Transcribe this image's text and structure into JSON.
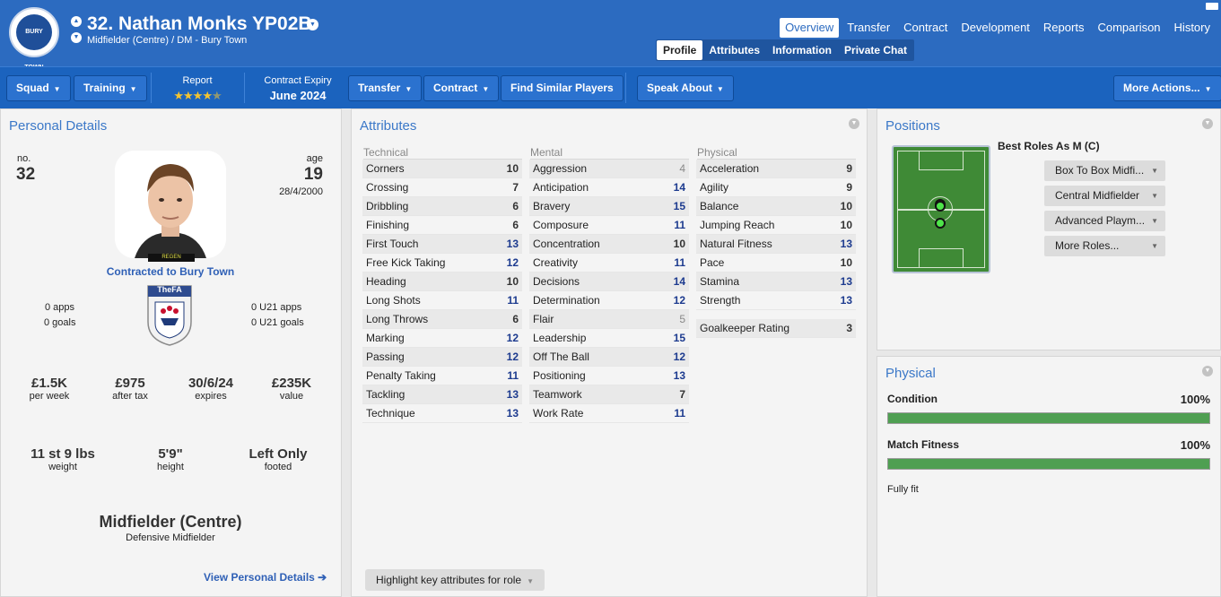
{
  "header": {
    "club_badge_text": "BURY TOWN FOOTBALL CLUB",
    "player_name": "32. Nathan Monks YP02B",
    "player_sub": "Midfielder (Centre) / DM - Bury Town",
    "tabs": [
      "Overview",
      "Transfer",
      "Contract",
      "Development",
      "Reports",
      "Comparison",
      "History"
    ],
    "active_tab": "Overview",
    "subtabs": [
      "Profile",
      "Attributes",
      "Information",
      "Private Chat"
    ],
    "active_subtab": "Profile"
  },
  "toolbar": {
    "squad": "Squad",
    "training": "Training",
    "report_label": "Report",
    "report_stars": 4.5,
    "contract_label": "Contract Expiry",
    "contract_value": "June 2024",
    "transfer": "Transfer",
    "contract": "Contract",
    "similar": "Find Similar Players",
    "speak": "Speak About",
    "more": "More Actions..."
  },
  "personal": {
    "title": "Personal Details",
    "no_label": "no.",
    "no": "32",
    "age_label": "age",
    "age": "19",
    "dob": "28/4/2000",
    "regen": "REGEN",
    "contracted": "Contracted to Bury Town",
    "apps": "0 apps",
    "goals": "0 goals",
    "u21apps": "0 U21 apps",
    "u21goals": "0 U21 goals",
    "fa_text": "TheFA",
    "per_week_v": "£1.5K",
    "per_week_l": "per week",
    "after_tax_v": "£975",
    "after_tax_l": "after tax",
    "expires_v": "30/6/24",
    "expires_l": "expires",
    "value_v": "£235K",
    "value_l": "value",
    "weight_v": "11 st 9 lbs",
    "weight_l": "weight",
    "height_v": "5'9\"",
    "height_l": "height",
    "foot_v": "Left Only",
    "foot_l": "footed",
    "position": "Midfielder (Centre)",
    "role": "Defensive Midfielder",
    "link": "View Personal Details ➔"
  },
  "attributes": {
    "title": "Attributes",
    "technical_h": "Technical",
    "mental_h": "Mental",
    "physical_h": "Physical",
    "technical": [
      [
        "Corners",
        "10"
      ],
      [
        "Crossing",
        "7"
      ],
      [
        "Dribbling",
        "6"
      ],
      [
        "Finishing",
        "6"
      ],
      [
        "First Touch",
        "13"
      ],
      [
        "Free Kick Taking",
        "12"
      ],
      [
        "Heading",
        "10"
      ],
      [
        "Long Shots",
        "11"
      ],
      [
        "Long Throws",
        "6"
      ],
      [
        "Marking",
        "12"
      ],
      [
        "Passing",
        "12"
      ],
      [
        "Penalty Taking",
        "11"
      ],
      [
        "Tackling",
        "13"
      ],
      [
        "Technique",
        "13"
      ]
    ],
    "mental": [
      [
        "Aggression",
        "4"
      ],
      [
        "Anticipation",
        "14"
      ],
      [
        "Bravery",
        "15"
      ],
      [
        "Composure",
        "11"
      ],
      [
        "Concentration",
        "10"
      ],
      [
        "Creativity",
        "11"
      ],
      [
        "Decisions",
        "14"
      ],
      [
        "Determination",
        "12"
      ],
      [
        "Flair",
        "5"
      ],
      [
        "Leadership",
        "15"
      ],
      [
        "Off The Ball",
        "12"
      ],
      [
        "Positioning",
        "13"
      ],
      [
        "Teamwork",
        "7"
      ],
      [
        "Work Rate",
        "11"
      ]
    ],
    "physical": [
      [
        "Acceleration",
        "9"
      ],
      [
        "Agility",
        "9"
      ],
      [
        "Balance",
        "10"
      ],
      [
        "Jumping Reach",
        "10"
      ],
      [
        "Natural Fitness",
        "13"
      ],
      [
        "Pace",
        "10"
      ],
      [
        "Stamina",
        "13"
      ],
      [
        "Strength",
        "13"
      ]
    ],
    "gk_label": "Goalkeeper Rating",
    "gk_value": "3",
    "highlight": "Highlight key attributes for role"
  },
  "positions": {
    "title": "Positions",
    "best_roles": "Best Roles As M (C)",
    "roles": [
      "Box To Box Midfi...",
      "Central Midfielder",
      "Advanced Playm...",
      "More Roles..."
    ]
  },
  "physical": {
    "title": "Physical",
    "condition_l": "Condition",
    "condition_v": "100%",
    "condition_pct": 100,
    "fitness_l": "Match Fitness",
    "fitness_v": "100%",
    "fitness_pct": 100,
    "status": "Fully fit"
  },
  "colors": {
    "header": "#2c6bc0",
    "toolbar": "#1b63be",
    "accent": "#3b78c8",
    "high_attr": "#1d3b8f",
    "bar": "#4f9f52"
  }
}
